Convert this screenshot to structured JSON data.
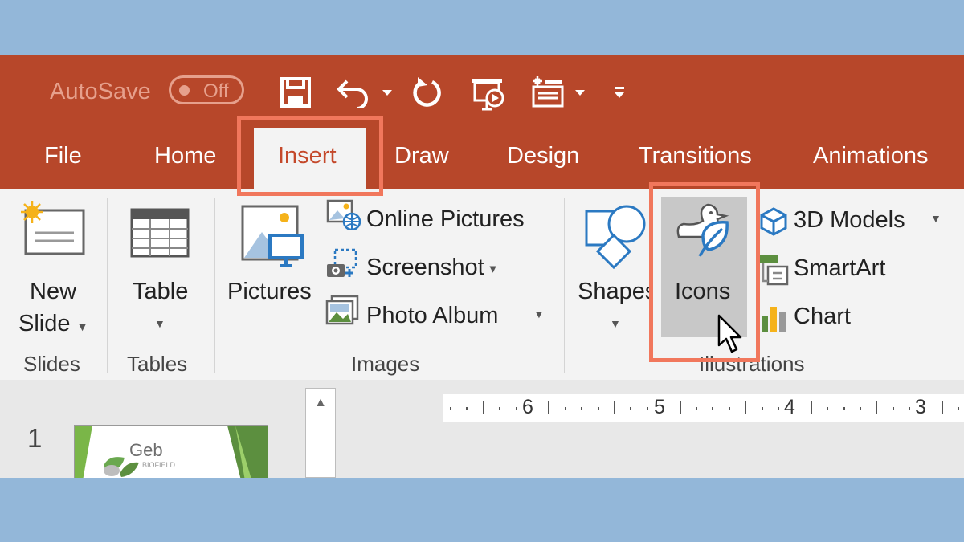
{
  "quick_access": {
    "autosave_label": "AutoSave",
    "autosave_state": "Off",
    "icons": [
      "save-icon",
      "undo-icon",
      "undo-dropdown-icon",
      "redo-icon",
      "present-from-start-icon",
      "touch-mode-icon",
      "customize-dropdown-icon"
    ]
  },
  "tabs": [
    {
      "label": "File"
    },
    {
      "label": "Home"
    },
    {
      "label": "Insert",
      "active": true
    },
    {
      "label": "Draw"
    },
    {
      "label": "Design"
    },
    {
      "label": "Transitions"
    },
    {
      "label": "Animations"
    }
  ],
  "ribbon": {
    "slides": {
      "new_slide_line1": "New",
      "new_slide_line2": "Slide",
      "group_label": "Slides"
    },
    "tables": {
      "table_label": "Table",
      "group_label": "Tables"
    },
    "images": {
      "pictures_label": "Pictures",
      "online_pictures_label": "Online Pictures",
      "screenshot_label": "Screenshot",
      "photo_album_label": "Photo Album",
      "group_label": "Images"
    },
    "illustrations": {
      "shapes_label": "Shapes",
      "icons_label": "Icons",
      "models_label": "3D Models",
      "smartart_label": "SmartArt",
      "chart_label": "Chart",
      "group_label": "Illustrations"
    }
  },
  "slide_panel": {
    "slide_number": "1",
    "thumbnail_title": "Geb",
    "thumbnail_subtitle": "BIOFIELD"
  },
  "ruler": {
    "labels": [
      "6",
      "5",
      "4",
      "3"
    ]
  },
  "colors": {
    "title_bar": "#b7472a",
    "ribbon": "#f3f3f3",
    "highlight": "#f1775c",
    "background": "#93b7d9"
  }
}
